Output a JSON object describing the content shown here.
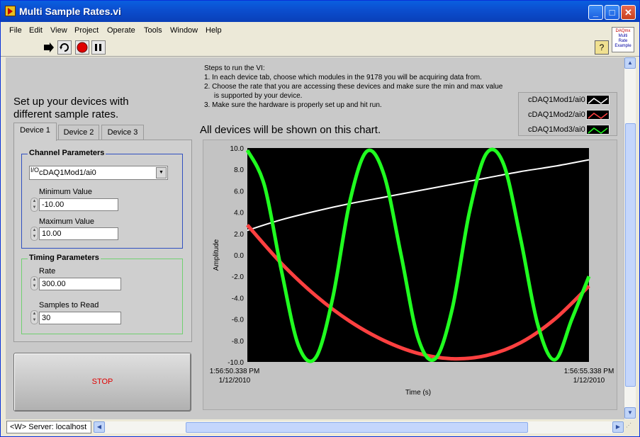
{
  "window": {
    "title": "Multi Sample Rates.vi"
  },
  "title_buttons": {
    "minimize": "_",
    "maximize": "□",
    "close": "✕"
  },
  "menu": [
    "File",
    "Edit",
    "View",
    "Project",
    "Operate",
    "Tools",
    "Window",
    "Help"
  ],
  "toolbar": {
    "run_icon": "run-arrow-icon",
    "continuous_icon": "run-continuously-icon",
    "abort_icon": "abort-icon",
    "pause_icon": "pause-icon",
    "help_label": "?"
  },
  "logo": {
    "lines": [
      "DAQmx",
      "Multi",
      "Rate",
      "Example"
    ]
  },
  "setup_heading": [
    "Set up your devices with",
    "different sample rates."
  ],
  "tabs": [
    "Device 1",
    "Device 2",
    "Device 3"
  ],
  "channel_params": {
    "title": "Channel Parameters",
    "channel_io": "I/O",
    "channel": "cDAQ1Mod1/ai0",
    "min_label": "Minimum Value",
    "min_value": "-10.00",
    "max_label": "Maximum Value",
    "max_value": "10.00"
  },
  "timing_params": {
    "title": "Timing Parameters",
    "rate_label": "Rate",
    "rate_value": "300.00",
    "samples_label": "Samples to Read",
    "samples_value": "30"
  },
  "stop_label": "STOP",
  "steps": [
    "Steps to run the VI:",
    "1. In each device tab, choose which modules in the 9178 you will be acquiring data from.",
    "2. Choose the rate that you are accessing these devices and make sure the min and max value",
    "     is supported by your device.",
    "3. Make sure the hardware is properly set up and hit run."
  ],
  "chart_heading": "All devices will be shown on this chart.",
  "status": {
    "server": "<W> Server: localhost"
  },
  "colors": {
    "white_series": "#ffffff",
    "red_series": "#ff4040",
    "green_series": "#20ff20",
    "plot_bg": "#000000"
  },
  "chart_data": {
    "type": "line",
    "ylabel": "Amplitude",
    "xlabel": "Time (s)",
    "ylim": [
      -10,
      10
    ],
    "yticks": [
      "10.0",
      "8.0",
      "6.0",
      "4.0",
      "2.0",
      "0.0",
      "-2.0",
      "-4.0",
      "-6.0",
      "-8.0",
      "-10.0"
    ],
    "x_start_label": [
      "1:56:50.338 PM",
      "1/12/2010"
    ],
    "x_end_label": [
      "1:56:55.338 PM",
      "1/12/2010"
    ],
    "xlim": [
      0,
      5
    ],
    "grid": false,
    "legend_position": "top-right",
    "series": [
      {
        "name": "cDAQ1Mod1/ai0",
        "color": "#ffffff",
        "x": [
          0,
          0.5,
          1.0,
          1.5,
          2.0,
          2.5,
          3.0,
          3.5,
          4.0,
          4.5,
          5.0
        ],
        "y": [
          2.3,
          3.3,
          4.1,
          4.8,
          5.4,
          6.0,
          6.6,
          7.2,
          7.8,
          8.3,
          8.9
        ]
      },
      {
        "name": "cDAQ1Mod2/ai0",
        "color": "#ff4040",
        "x": [
          0,
          0.5,
          1.0,
          1.5,
          2.0,
          2.5,
          3.0,
          3.5,
          4.0,
          4.5,
          5.0
        ],
        "y": [
          2.8,
          -0.8,
          -3.8,
          -6.2,
          -8.0,
          -9.2,
          -9.7,
          -9.4,
          -8.2,
          -6.0,
          -2.9
        ]
      },
      {
        "name": "cDAQ1Mod3/ai0",
        "color": "#20ff20",
        "x": [
          0,
          0.25,
          0.5,
          0.75,
          1.0,
          1.25,
          1.5,
          1.75,
          2.0,
          2.25,
          2.5,
          2.75,
          3.0,
          3.25,
          3.5,
          3.75,
          4.0,
          4.25,
          4.5,
          4.75,
          5.0
        ],
        "y": [
          9.8,
          6.5,
          -1.5,
          -8.5,
          -9.6,
          -4.0,
          5.0,
          9.7,
          7.5,
          0.0,
          -7.8,
          -9.7,
          -5.0,
          4.0,
          9.5,
          8.5,
          1.5,
          -6.5,
          -9.8,
          -6.0,
          -2.0
        ]
      }
    ]
  }
}
